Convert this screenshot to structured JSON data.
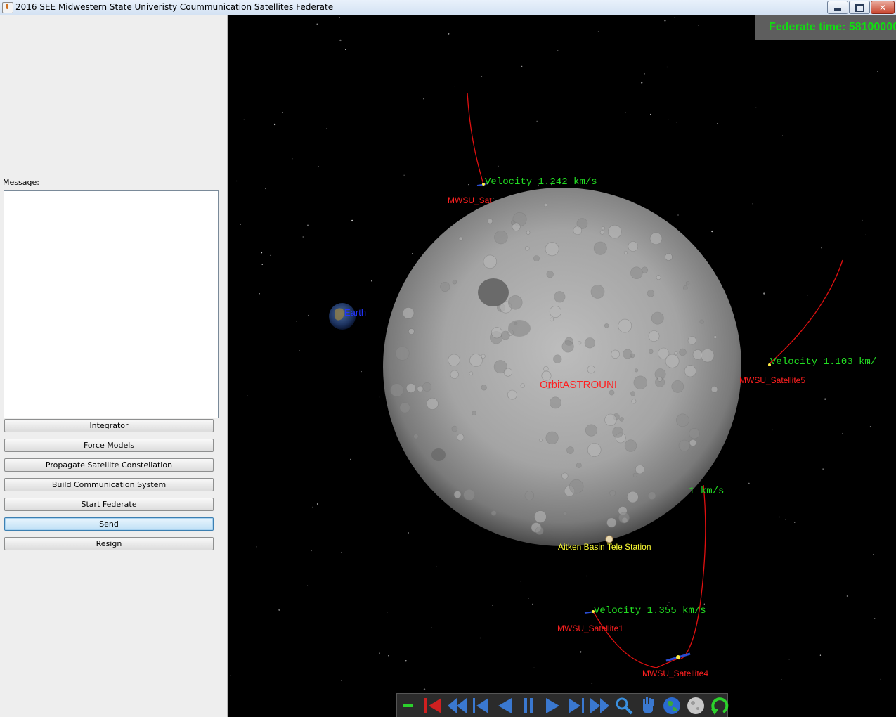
{
  "window": {
    "title": "2016 SEE Midwestern State Univeristy Coummunication Satellites Federate"
  },
  "left_panel": {
    "message_label": "Message:",
    "message_text": "",
    "buttons": [
      {
        "label": "Integrator"
      },
      {
        "label": "Force Models"
      },
      {
        "label": "Propagate Satellite Constellation"
      },
      {
        "label": "Build Communication System"
      },
      {
        "label": "Start Federate"
      },
      {
        "label": "Send"
      },
      {
        "label": "Resign"
      }
    ]
  },
  "viewport": {
    "federate_time": "Federate time: 58100000",
    "labels": {
      "earth": "Earth",
      "moon": "OrbitASTROUNI",
      "station": "Aitken Basin Tele Station",
      "sat_top_name": "MWSU_Sat",
      "sat_top_velocity": "Velocity 1.242 km/s",
      "sat5_name": "MWSU_Satellite5",
      "sat5_velocity": "Velocity 1.103 km/",
      "hidden_velocity": "1 km/s",
      "sat1_name": "MWSU_Satellite1",
      "sat1_velocity": "Velocity 1.355 km/s",
      "sat4_name": "MWSU_Satellite4"
    },
    "colors": {
      "orbit": "#e01010",
      "velocity_text": "#22dd22",
      "sat_label": "#ff2020",
      "station_label": "#ffff33",
      "earth_label": "#2233ff",
      "fed_time": "#11dd11"
    }
  },
  "toolbar": {
    "icons": [
      "zoom-out-icon",
      "skip-to-start-icon",
      "fast-rewind-icon",
      "step-back-icon",
      "play-reverse-icon",
      "pause-icon",
      "play-icon",
      "step-forward-icon",
      "fast-forward-icon",
      "zoom-icon",
      "pan-hand-icon",
      "earth-view-icon",
      "moon-view-icon",
      "rotate-icon"
    ]
  }
}
